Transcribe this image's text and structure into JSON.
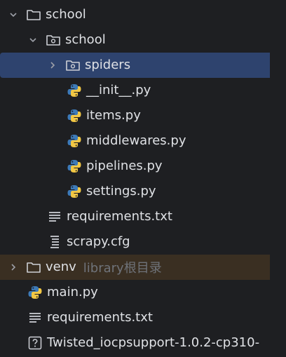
{
  "tree": {
    "items": [
      {
        "label": "school",
        "type": "folder",
        "expanded": true
      },
      {
        "label": "school",
        "type": "package",
        "expanded": true
      },
      {
        "label": "spiders",
        "type": "package",
        "expanded": false,
        "selected": true
      },
      {
        "label": "__init__.py",
        "type": "python"
      },
      {
        "label": "items.py",
        "type": "python"
      },
      {
        "label": "middlewares.py",
        "type": "python"
      },
      {
        "label": "pipelines.py",
        "type": "python"
      },
      {
        "label": "settings.py",
        "type": "python"
      },
      {
        "label": "requirements.txt",
        "type": "text"
      },
      {
        "label": "scrapy.cfg",
        "type": "config"
      },
      {
        "label": "venv",
        "type": "folder",
        "expanded": false,
        "hint": "library根目录"
      },
      {
        "label": "main.py",
        "type": "python"
      },
      {
        "label": "requirements.txt",
        "type": "text"
      },
      {
        "label": "Twisted_iocpsupport-1.0.2-cp310-",
        "type": "unknown"
      }
    ]
  },
  "colors": {
    "background": "#1e1f22",
    "selection": "#2e436e",
    "excluded_row": "#3a2f22",
    "text": "#dfe1e5",
    "hint": "#6f737a"
  }
}
